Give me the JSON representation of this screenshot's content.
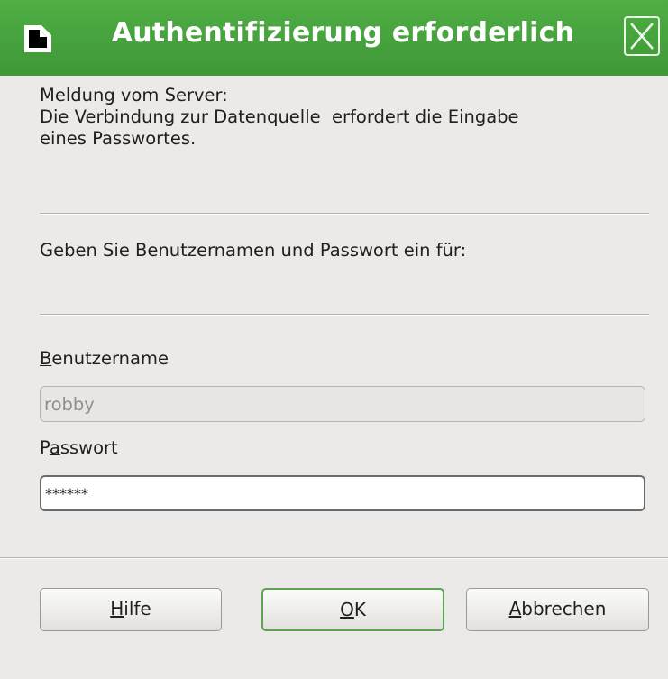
{
  "window": {
    "title": "Authentifizierung erforderlich",
    "icons": {
      "app": "document-icon",
      "close": "close-icon"
    }
  },
  "message": {
    "line1": "Meldung vom Server:",
    "line2": "Die Verbindung zur Datenquelle  erfordert die Eingabe",
    "line3": "eines Passwortes."
  },
  "prompt": "Geben Sie Benutzernamen und Passwort ein für:",
  "username": {
    "label_mnemonic": "B",
    "label_rest": "enutzername",
    "value": "robby"
  },
  "password": {
    "label_pre": "P",
    "label_mnemonic": "a",
    "label_rest": "sswort",
    "value": "******"
  },
  "buttons": {
    "help_mnemonic": "H",
    "help_rest": "ilfe",
    "ok_mnemonic": "O",
    "ok_rest": "K",
    "cancel_mnemonic": "A",
    "cancel_rest": "bbrechen"
  },
  "colors": {
    "titlebar": "#49a33f",
    "background": "#eceae8",
    "default_button_border": "#5aa54f"
  }
}
